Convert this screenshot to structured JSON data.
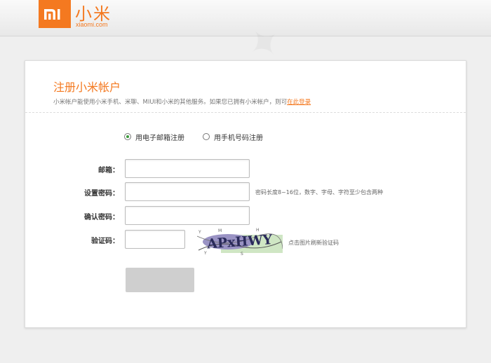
{
  "brand": {
    "title": "小米",
    "domain": "xiaomi.com",
    "accent_color": "#f47920"
  },
  "register": {
    "title": "注册小米帐户",
    "description": "小米帐户能使用小米手机、米聊、MIUI和小米的其他服务。如果您已拥有小米帐户，则可",
    "login_link": "在此登录",
    "options": [
      {
        "label": "用电子邮箱注册",
        "selected": true
      },
      {
        "label": "用手机号码注册",
        "selected": false
      }
    ],
    "fields": {
      "email": {
        "label": "邮箱：",
        "value": ""
      },
      "password": {
        "label": "设置密码：",
        "value": "",
        "hint": "密码长度8~16位，数字、字母、字符至少包含两种"
      },
      "confirm": {
        "label": "确认密码：",
        "value": ""
      },
      "captcha": {
        "label": "验证码：",
        "value": "",
        "hint": "点击图片刷新验证码",
        "image_text": "APxHWY"
      }
    },
    "submit_label": ""
  }
}
